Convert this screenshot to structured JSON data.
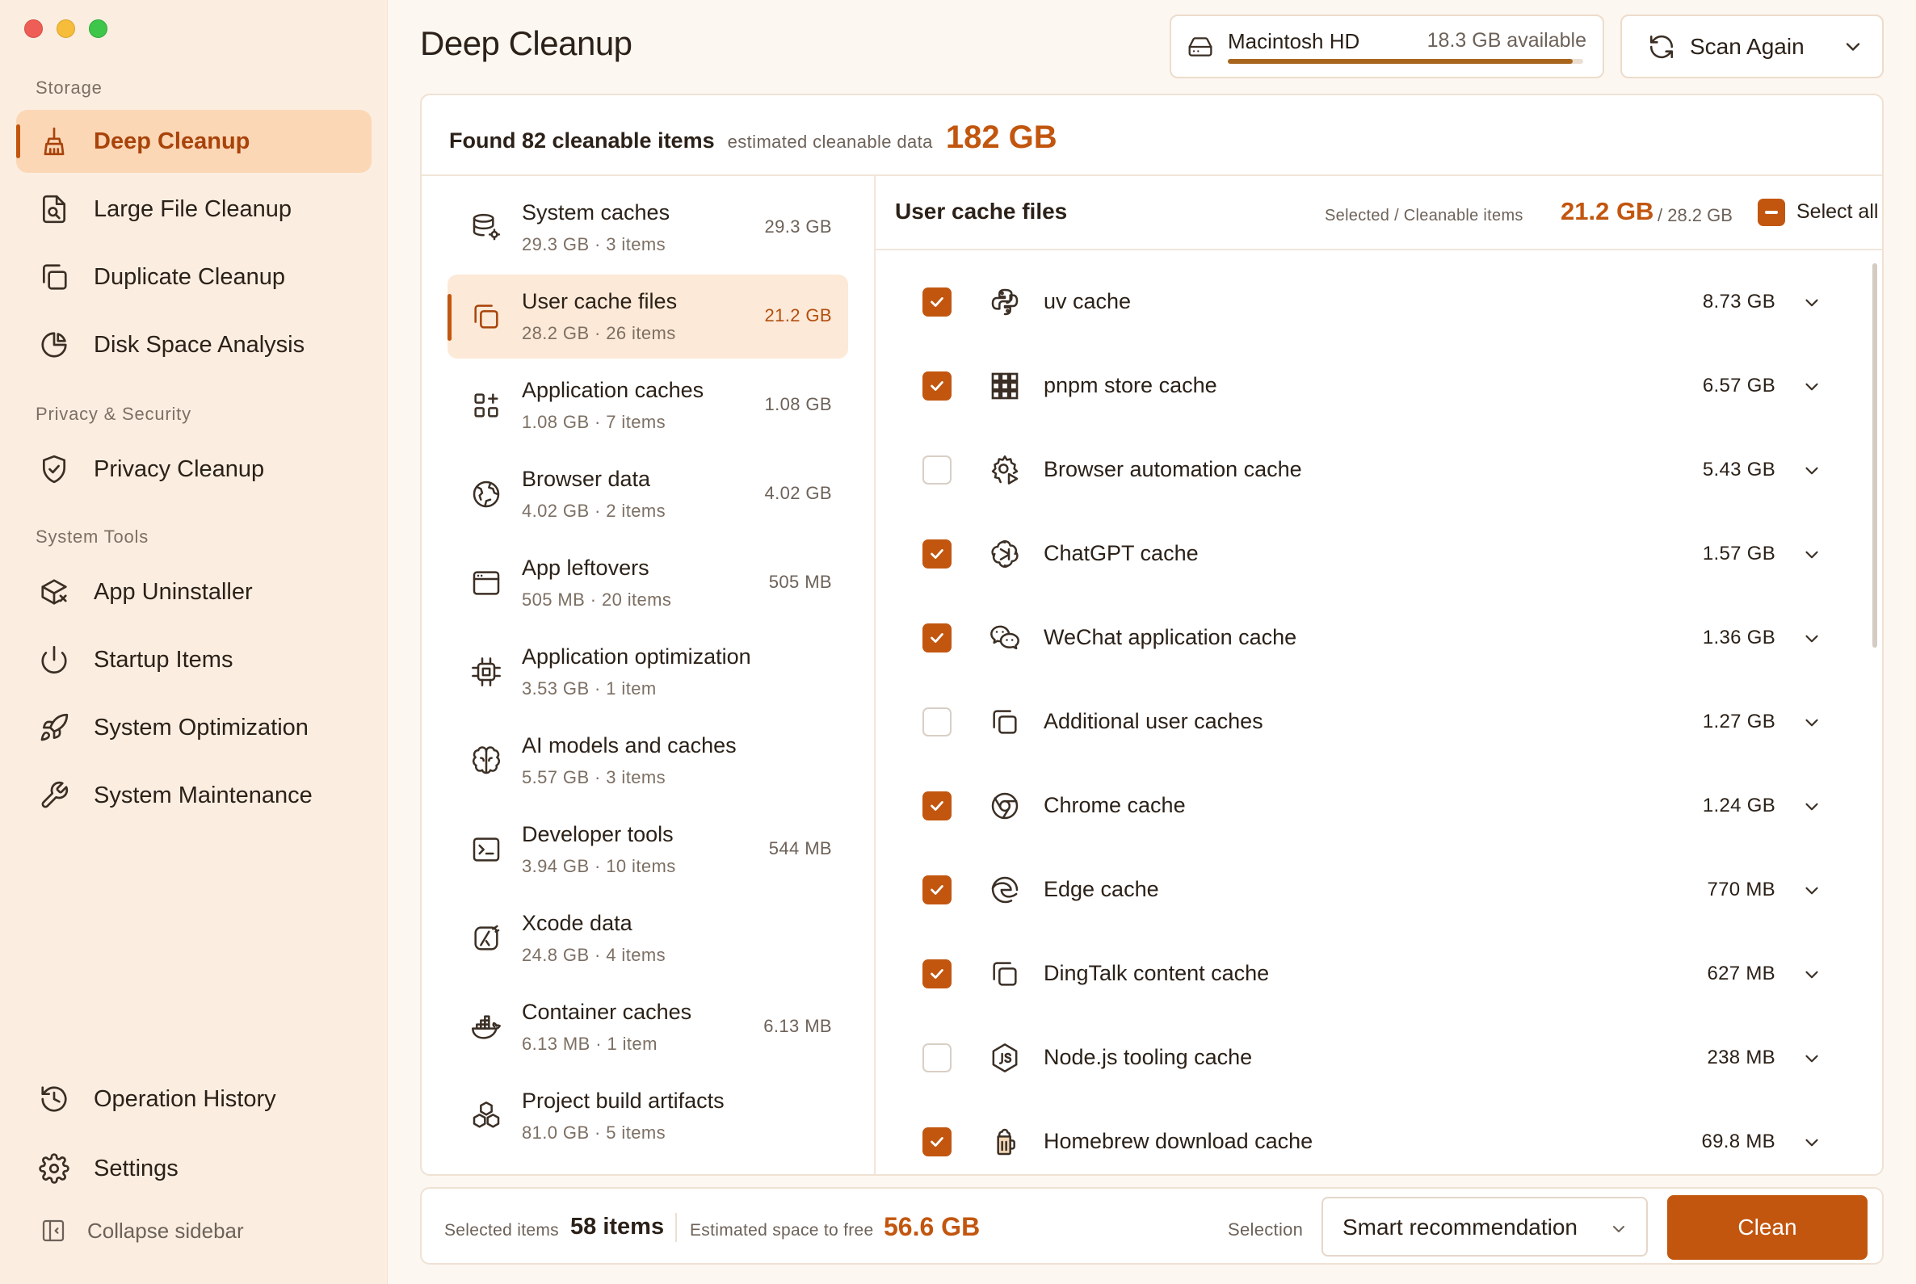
{
  "sidebar": {
    "sections": [
      {
        "title": "Storage"
      },
      {
        "title": "Privacy & Security"
      },
      {
        "title": "System Tools"
      }
    ],
    "items": [
      {
        "label": "Deep Cleanup",
        "icon": "broom-icon",
        "active": true
      },
      {
        "label": "Large File Cleanup",
        "icon": "file-search-icon"
      },
      {
        "label": "Duplicate Cleanup",
        "icon": "copy-icon"
      },
      {
        "label": "Disk Space Analysis",
        "icon": "pie-chart-icon"
      },
      {
        "label": "Privacy Cleanup",
        "icon": "shield-check-icon"
      },
      {
        "label": "App Uninstaller",
        "icon": "package-x-icon"
      },
      {
        "label": "Startup Items",
        "icon": "power-icon"
      },
      {
        "label": "System Optimization",
        "icon": "rocket-icon"
      },
      {
        "label": "System Maintenance",
        "icon": "wrench-icon"
      },
      {
        "label": "Operation History",
        "icon": "history-icon"
      },
      {
        "label": "Settings",
        "icon": "gear-icon"
      }
    ],
    "collapse_label": "Collapse sidebar"
  },
  "header": {
    "title": "Deep Cleanup",
    "disk": {
      "name": "Macintosh HD",
      "available": "18.3 GB available",
      "used_fraction": 0.97
    },
    "scan_label": "Scan Again"
  },
  "summary": {
    "found": "Found 82 cleanable items",
    "estimated_label": "estimated cleanable data",
    "estimated_value": "182 GB"
  },
  "categories": [
    {
      "name": "System caches",
      "sub": "29.3 GB · 3 items",
      "size": "29.3 GB",
      "icon": "database-gear-icon"
    },
    {
      "name": "User cache files",
      "sub": "28.2 GB · 26 items",
      "size": "21.2 GB",
      "icon": "copy-icon",
      "active": true
    },
    {
      "name": "Application caches",
      "sub": "1.08 GB · 7 items",
      "size": "1.08 GB",
      "icon": "grid-plus-icon"
    },
    {
      "name": "Browser data",
      "sub": "4.02 GB · 2 items",
      "size": "4.02 GB",
      "icon": "globe-icon"
    },
    {
      "name": "App leftovers",
      "sub": "505 MB · 20 items",
      "size": "505 MB",
      "icon": "window-icon"
    },
    {
      "name": "Application optimization",
      "sub": "3.53 GB · 1 item",
      "size": "",
      "icon": "chip-icon"
    },
    {
      "name": "AI models and caches",
      "sub": "5.57 GB · 3 items",
      "size": "",
      "icon": "brain-icon"
    },
    {
      "name": "Developer tools",
      "sub": "3.94 GB · 10 items",
      "size": "544 MB",
      "icon": "terminal-icon"
    },
    {
      "name": "Xcode data",
      "sub": "24.8 GB · 4 items",
      "size": "",
      "icon": "xcode-icon"
    },
    {
      "name": "Container caches",
      "sub": "6.13 MB · 1 item",
      "size": "6.13 MB",
      "icon": "docker-icon"
    },
    {
      "name": "Project build artifacts",
      "sub": "81.0 GB · 5 items",
      "size": "",
      "icon": "boxes-icon"
    }
  ],
  "detail": {
    "title": "User cache files",
    "selected_label": "Selected / Cleanable items",
    "selected_value": "21.2 GB",
    "total_value": "/ 28.2 GB",
    "select_all_label": "Select all",
    "items": [
      {
        "name": "uv cache",
        "size": "8.73 GB",
        "checked": true,
        "icon": "python-icon"
      },
      {
        "name": "pnpm store cache",
        "size": "6.57 GB",
        "checked": true,
        "icon": "pnpm-icon"
      },
      {
        "name": "Browser automation cache",
        "size": "5.43 GB",
        "checked": false,
        "icon": "gear-play-icon"
      },
      {
        "name": "ChatGPT cache",
        "size": "1.57 GB",
        "checked": true,
        "icon": "openai-icon"
      },
      {
        "name": "WeChat application cache",
        "size": "1.36 GB",
        "checked": true,
        "icon": "wechat-icon"
      },
      {
        "name": "Additional user caches",
        "size": "1.27 GB",
        "checked": false,
        "icon": "copy-icon"
      },
      {
        "name": "Chrome cache",
        "size": "1.24 GB",
        "checked": true,
        "icon": "chrome-icon"
      },
      {
        "name": "Edge cache",
        "size": "770 MB",
        "checked": true,
        "icon": "edge-icon"
      },
      {
        "name": "DingTalk content cache",
        "size": "627 MB",
        "checked": true,
        "icon": "copy-icon"
      },
      {
        "name": "Node.js tooling cache",
        "size": "238 MB",
        "checked": false,
        "icon": "nodejs-icon"
      },
      {
        "name": "Homebrew download cache",
        "size": "69.8 MB",
        "checked": true,
        "icon": "homebrew-icon"
      }
    ]
  },
  "footer": {
    "selected_label": "Selected items",
    "selected_value": "58 items",
    "space_label": "Estimated space to free",
    "space_value": "56.6 GB",
    "selection_label": "Selection",
    "selection_value": "Smart recommendation",
    "clean_label": "Clean"
  },
  "colors": {
    "accent": "#c2560f",
    "sidebar_bg": "#fbeee1",
    "active_bg": "#fcd7b6"
  }
}
